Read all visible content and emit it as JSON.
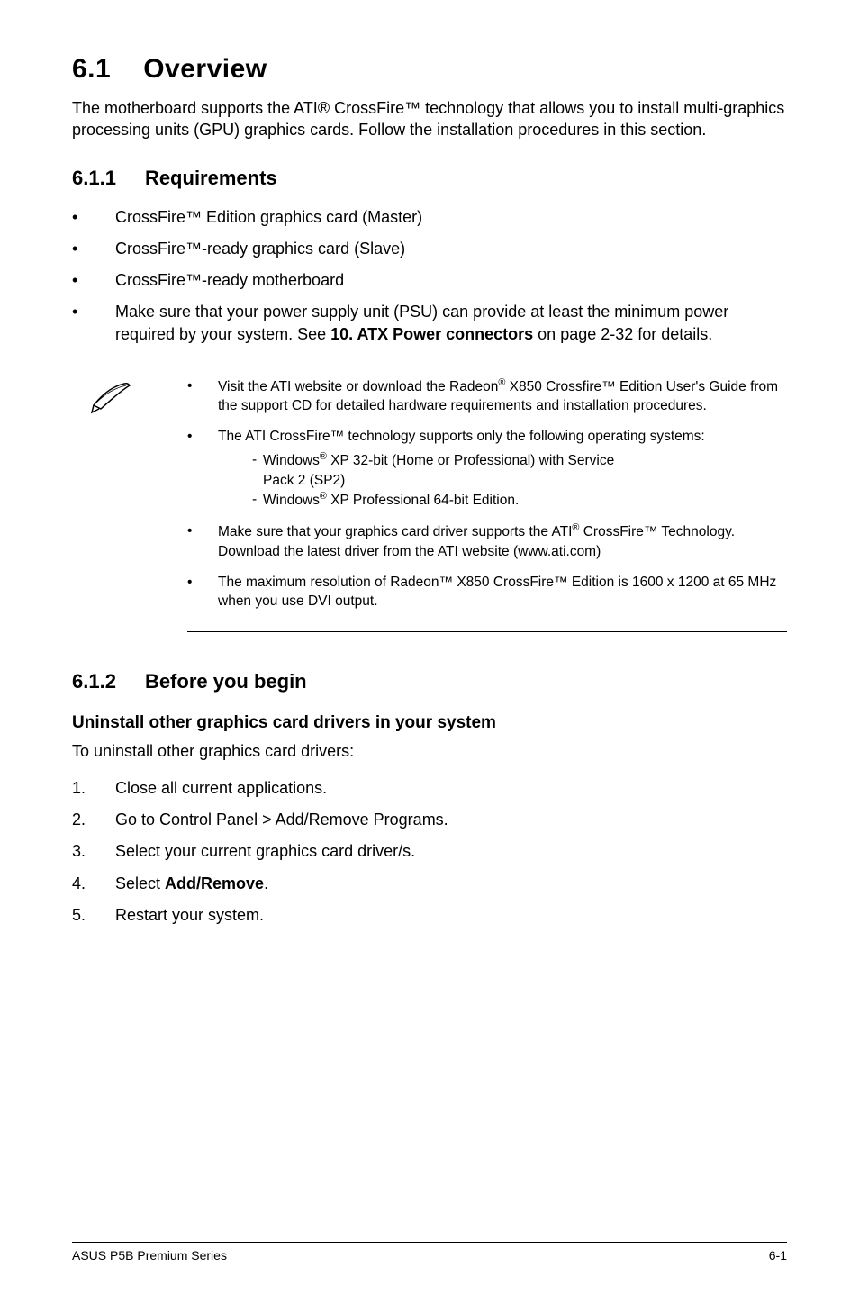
{
  "title": {
    "num": "6.1",
    "text": "Overview"
  },
  "intro": "The motherboard supports the ATI® CrossFire™ technology that allows you to install multi-graphics processing units (GPU) graphics cards. Follow the installation procedures in this section.",
  "sec611": {
    "num": "6.1.1",
    "title": "Requirements"
  },
  "req": [
    "CrossFire™ Edition graphics card (Master)",
    "CrossFire™-ready graphics card (Slave)",
    "CrossFire™-ready motherboard"
  ],
  "req_last_pre": "Make sure that your power supply unit (PSU) can provide at least the minimum power required by your system. See ",
  "req_last_bold": "10. ATX Power connectors",
  "req_last_post": " on page 2-32 for details.",
  "note1_pre": "Visit the ATI website or download the Radeon",
  "note1_post": " X850 Crossfire™ Edition User's Guide from the support CD for detailed hardware requirements and installation procedures.",
  "note2_intro": "The ATI CrossFire™ technology supports only the following operating systems:",
  "note2_os1_pre": "Windows",
  "note2_os1_post": " XP 32-bit  (Home or Professional) with Service ",
  "note2_os1_line2": "Pack 2 (SP2)",
  "note2_os2_pre": "Windows",
  "note2_os2_post": " XP Professional 64-bit Edition.",
  "note3_pre": "Make sure that your graphics card driver supports the ATI",
  "note3_post": " CrossFire™ Technology. Download the latest driver from the ATI website (www.ati.com)",
  "note4": "The maximum resolution of Radeon™ X850 CrossFire™ Edition is 1600 x 1200 at 65 MHz when you use DVI output.",
  "sec612": {
    "num": "6.1.2",
    "title": "Before you begin"
  },
  "uninstall_head": "Uninstall other graphics card drivers in your system",
  "uninstall_lead": "To uninstall other graphics card drivers:",
  "steps": {
    "s1": "Close all current applications.",
    "s2": "Go to Control Panel > Add/Remove Programs.",
    "s3": "Select your current graphics card driver/s.",
    "s4_pre": "Select ",
    "s4_bold": "Add/Remove",
    "s4_post": ".",
    "s5": "Restart your system."
  },
  "footer": {
    "left": "ASUS P5B Premium Series",
    "right": "6-1"
  }
}
